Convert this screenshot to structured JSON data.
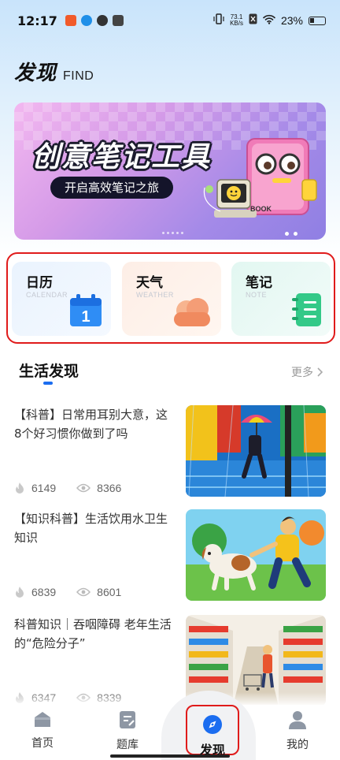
{
  "status_bar": {
    "time": "12:17",
    "net_speed_value": "73.1",
    "net_speed_unit": "KB/s",
    "battery": "23%"
  },
  "header": {
    "title": "发现",
    "subtitle": "FIND"
  },
  "banner": {
    "title": "创意笔记工具",
    "subtitle": "开启高效笔记之旅",
    "book_label": "BOOK"
  },
  "quick_tools": [
    {
      "label": "日历",
      "sub": "CALENDAR",
      "icon": "calendar-icon",
      "calendar_day": "1"
    },
    {
      "label": "天气",
      "sub": "WEATHER",
      "icon": "cloud-icon"
    },
    {
      "label": "笔记",
      "sub": "NOTE",
      "icon": "notebook-icon"
    }
  ],
  "section": {
    "title": "生活发现",
    "more": "更多"
  },
  "articles": [
    {
      "title": "【科普】日常用耳别大意，这8个好习惯你做到了吗",
      "likes": "6149",
      "views": "8366",
      "thumb": "rainy-street-illustration"
    },
    {
      "title": "【知识科普】生活饮用水卫生知识",
      "likes": "6839",
      "views": "8601",
      "thumb": "man-with-dog-illustration"
    },
    {
      "title": "科普知识｜吞咽障碍 老年生活的“危险分子”",
      "likes": "6347",
      "views": "8339",
      "thumb": "supermarket-illustration"
    }
  ],
  "bottom_nav": [
    {
      "label": "首页",
      "icon": "home-icon"
    },
    {
      "label": "题库",
      "icon": "question-bank-icon"
    },
    {
      "label": "发现",
      "icon": "compass-icon",
      "active": true
    },
    {
      "label": "我的",
      "icon": "user-icon"
    }
  ],
  "colors": {
    "accent": "#1b6df0",
    "highlight_border": "#e01b1b"
  }
}
